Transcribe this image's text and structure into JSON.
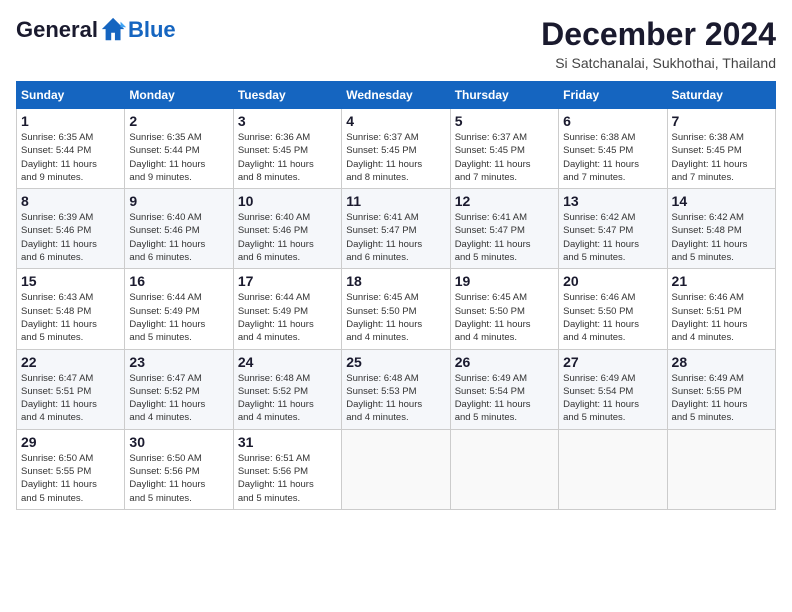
{
  "logo": {
    "general": "General",
    "blue": "Blue"
  },
  "header": {
    "month": "December 2024",
    "location": "Si Satchanalai, Sukhothai, Thailand"
  },
  "weekdays": [
    "Sunday",
    "Monday",
    "Tuesday",
    "Wednesday",
    "Thursday",
    "Friday",
    "Saturday"
  ],
  "weeks": [
    [
      {
        "day": 1,
        "sunrise": "6:35 AM",
        "sunset": "5:44 PM",
        "daylight": "11 hours and 9 minutes."
      },
      {
        "day": 2,
        "sunrise": "6:35 AM",
        "sunset": "5:44 PM",
        "daylight": "11 hours and 9 minutes."
      },
      {
        "day": 3,
        "sunrise": "6:36 AM",
        "sunset": "5:45 PM",
        "daylight": "11 hours and 8 minutes."
      },
      {
        "day": 4,
        "sunrise": "6:37 AM",
        "sunset": "5:45 PM",
        "daylight": "11 hours and 8 minutes."
      },
      {
        "day": 5,
        "sunrise": "6:37 AM",
        "sunset": "5:45 PM",
        "daylight": "11 hours and 7 minutes."
      },
      {
        "day": 6,
        "sunrise": "6:38 AM",
        "sunset": "5:45 PM",
        "daylight": "11 hours and 7 minutes."
      },
      {
        "day": 7,
        "sunrise": "6:38 AM",
        "sunset": "5:45 PM",
        "daylight": "11 hours and 7 minutes."
      }
    ],
    [
      {
        "day": 8,
        "sunrise": "6:39 AM",
        "sunset": "5:46 PM",
        "daylight": "11 hours and 6 minutes."
      },
      {
        "day": 9,
        "sunrise": "6:40 AM",
        "sunset": "5:46 PM",
        "daylight": "11 hours and 6 minutes."
      },
      {
        "day": 10,
        "sunrise": "6:40 AM",
        "sunset": "5:46 PM",
        "daylight": "11 hours and 6 minutes."
      },
      {
        "day": 11,
        "sunrise": "6:41 AM",
        "sunset": "5:47 PM",
        "daylight": "11 hours and 6 minutes."
      },
      {
        "day": 12,
        "sunrise": "6:41 AM",
        "sunset": "5:47 PM",
        "daylight": "11 hours and 5 minutes."
      },
      {
        "day": 13,
        "sunrise": "6:42 AM",
        "sunset": "5:47 PM",
        "daylight": "11 hours and 5 minutes."
      },
      {
        "day": 14,
        "sunrise": "6:42 AM",
        "sunset": "5:48 PM",
        "daylight": "11 hours and 5 minutes."
      }
    ],
    [
      {
        "day": 15,
        "sunrise": "6:43 AM",
        "sunset": "5:48 PM",
        "daylight": "11 hours and 5 minutes."
      },
      {
        "day": 16,
        "sunrise": "6:44 AM",
        "sunset": "5:49 PM",
        "daylight": "11 hours and 5 minutes."
      },
      {
        "day": 17,
        "sunrise": "6:44 AM",
        "sunset": "5:49 PM",
        "daylight": "11 hours and 4 minutes."
      },
      {
        "day": 18,
        "sunrise": "6:45 AM",
        "sunset": "5:50 PM",
        "daylight": "11 hours and 4 minutes."
      },
      {
        "day": 19,
        "sunrise": "6:45 AM",
        "sunset": "5:50 PM",
        "daylight": "11 hours and 4 minutes."
      },
      {
        "day": 20,
        "sunrise": "6:46 AM",
        "sunset": "5:50 PM",
        "daylight": "11 hours and 4 minutes."
      },
      {
        "day": 21,
        "sunrise": "6:46 AM",
        "sunset": "5:51 PM",
        "daylight": "11 hours and 4 minutes."
      }
    ],
    [
      {
        "day": 22,
        "sunrise": "6:47 AM",
        "sunset": "5:51 PM",
        "daylight": "11 hours and 4 minutes."
      },
      {
        "day": 23,
        "sunrise": "6:47 AM",
        "sunset": "5:52 PM",
        "daylight": "11 hours and 4 minutes."
      },
      {
        "day": 24,
        "sunrise": "6:48 AM",
        "sunset": "5:52 PM",
        "daylight": "11 hours and 4 minutes."
      },
      {
        "day": 25,
        "sunrise": "6:48 AM",
        "sunset": "5:53 PM",
        "daylight": "11 hours and 4 minutes."
      },
      {
        "day": 26,
        "sunrise": "6:49 AM",
        "sunset": "5:54 PM",
        "daylight": "11 hours and 5 minutes."
      },
      {
        "day": 27,
        "sunrise": "6:49 AM",
        "sunset": "5:54 PM",
        "daylight": "11 hours and 5 minutes."
      },
      {
        "day": 28,
        "sunrise": "6:49 AM",
        "sunset": "5:55 PM",
        "daylight": "11 hours and 5 minutes."
      }
    ],
    [
      {
        "day": 29,
        "sunrise": "6:50 AM",
        "sunset": "5:55 PM",
        "daylight": "11 hours and 5 minutes."
      },
      {
        "day": 30,
        "sunrise": "6:50 AM",
        "sunset": "5:56 PM",
        "daylight": "11 hours and 5 minutes."
      },
      {
        "day": 31,
        "sunrise": "6:51 AM",
        "sunset": "5:56 PM",
        "daylight": "11 hours and 5 minutes."
      },
      null,
      null,
      null,
      null
    ]
  ]
}
